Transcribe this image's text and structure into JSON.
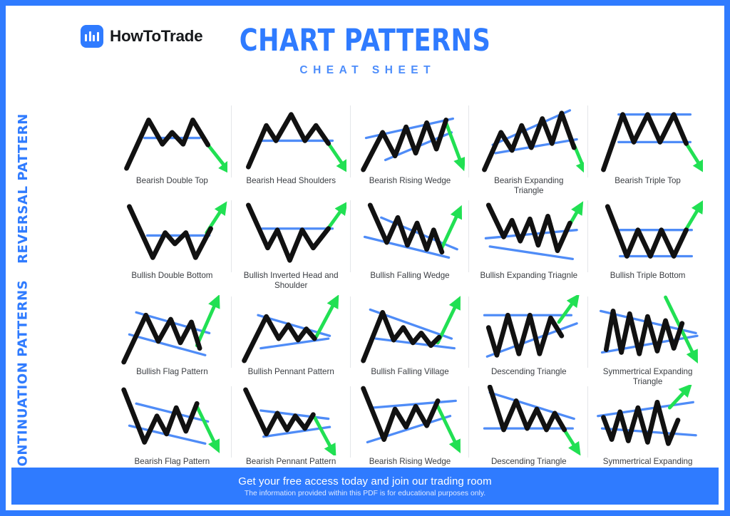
{
  "header": {
    "brand_name": "HowToTrade",
    "brand_icon": "bar-chart-logo-icon",
    "title": "CHART PATTERNS",
    "subtitle": "CHEAT SHEET"
  },
  "accent_colors": {
    "brand_blue": "#2f7bff",
    "guide_blue": "#4f8cf7",
    "breakout_green": "#21e053",
    "price_black": "#111111",
    "label_gray": "#3a3d42",
    "divider_gray": "#e4e6e9"
  },
  "sections": [
    {
      "rail_label": "REVERSAL PATTERN",
      "rows": [
        [
          {
            "label": "Bearish Double Top",
            "figure": "bearish-double-top",
            "direction": "bearish"
          },
          {
            "label": "Bearish Head Shoulders",
            "figure": "bearish-head-shoulders",
            "direction": "bearish"
          },
          {
            "label": "Bearish Rising Wedge",
            "figure": "bearish-rising-wedge",
            "direction": "bearish"
          },
          {
            "label": "Bearish Expanding Triangle",
            "figure": "bearish-expanding-triangle",
            "direction": "bearish"
          },
          {
            "label": "Bearish Triple Top",
            "figure": "bearish-triple-top",
            "direction": "bearish"
          }
        ],
        [
          {
            "label": "Bullish Double Bottom",
            "figure": "bullish-double-bottom",
            "direction": "bullish"
          },
          {
            "label": "Bullish Inverted Head and Shoulder",
            "figure": "bullish-inverted-head-shoulder",
            "direction": "bullish"
          },
          {
            "label": "Bullish Falling Wedge",
            "figure": "bullish-falling-wedge",
            "direction": "bullish"
          },
          {
            "label": "Bullish Expanding Triagnle",
            "figure": "bullish-expanding-triangle",
            "direction": "bullish"
          },
          {
            "label": "Bullish Triple Bottom",
            "figure": "bullish-triple-bottom",
            "direction": "bullish"
          }
        ]
      ]
    },
    {
      "rail_label": "CONTINUATION PATTERNS",
      "rows": [
        [
          {
            "label": "Bullish Flag Pattern",
            "figure": "bullish-flag",
            "direction": "bullish"
          },
          {
            "label": "Bullish Pennant Pattern",
            "figure": "bullish-pennant",
            "direction": "bullish"
          },
          {
            "label": "Bullish Falling Village",
            "figure": "bullish-falling-village",
            "direction": "bullish"
          },
          {
            "label": "Descending Triangle",
            "figure": "descending-triangle-up",
            "direction": "bullish"
          },
          {
            "label": "Symmertrical Expanding Triangle",
            "figure": "symmetrical-expanding-triangle-down",
            "direction": "bearish"
          }
        ],
        [
          {
            "label": "Bearish Flag Pattern",
            "figure": "bearish-flag",
            "direction": "bearish"
          },
          {
            "label": "Bearish Pennant Pattern",
            "figure": "bearish-pennant",
            "direction": "bearish"
          },
          {
            "label": "Bearish Rising Wedge",
            "figure": "bearish-rising-wedge-2",
            "direction": "bearish"
          },
          {
            "label": "Descending Triangle",
            "figure": "descending-triangle-down",
            "direction": "bearish"
          },
          {
            "label": "Symmertrical Expanding Triangle",
            "figure": "symmetrical-expanding-triangle-up",
            "direction": "bullish"
          }
        ]
      ]
    }
  ],
  "footer": {
    "headline": "Get your free access today and join our trading room",
    "disclaimer": "The information provided within this PDF is for educational purposes only."
  }
}
